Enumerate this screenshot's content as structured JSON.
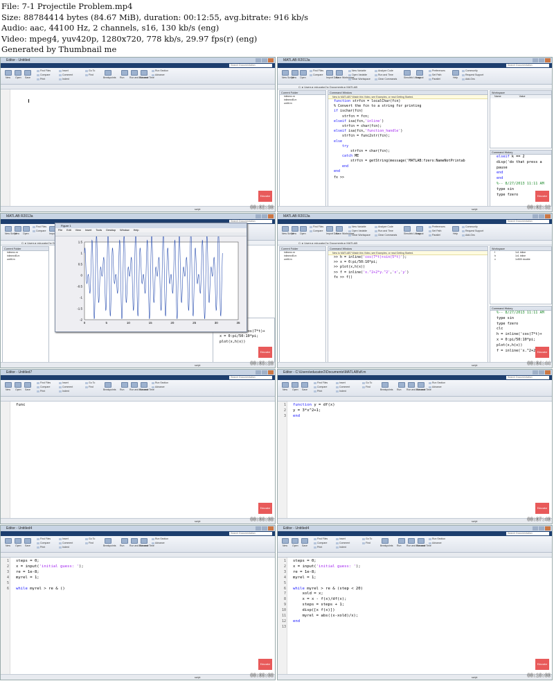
{
  "header": {
    "file": "File: 7-1 Projectile Problem.mp4",
    "size": "Size: 88784414 bytes (84.67 MiB), duration: 00:12:55, avg.bitrate: 916 kb/s",
    "audio": "Audio: aac, 44100 Hz, 2 channels, s16, 130 kb/s (eng)",
    "video": "Video: mpeg4, yuv420p, 1280x720, 778 kb/s, 29.97 fps(r) (eng)",
    "generated": "Generated by Thumbnail me"
  },
  "common": {
    "brand": "Educator",
    "search_placeholder": "Search Documentation",
    "tabs_editor": [
      "HOME",
      "PUBLISH",
      "VIEW"
    ],
    "tabs_desktop": [
      "HOME",
      "PLOTS",
      "APPS"
    ],
    "editor_buttons": [
      "New",
      "Open",
      "Save",
      "Find Files",
      "Compare",
      "Print",
      "Insert",
      "Comment",
      "Indent",
      "Go To",
      "Find",
      "Breakpoints",
      "Run",
      "Run and Advance",
      "Run and Time",
      "Run Section",
      "Advance"
    ],
    "desktop_buttons": [
      "New Script",
      "New",
      "Open",
      "Find Files",
      "Compare",
      "Import Data",
      "Save Workspace",
      "New Variable",
      "Open Variable",
      "Clear Workspace",
      "Analyze Code",
      "Run and Time",
      "Clear Commands",
      "Simulink Library",
      "Layout",
      "Preferences",
      "Set Path",
      "Parallel",
      "Help",
      "Community",
      "Request Support",
      "Add-Ons"
    ],
    "path": "C: ▸ Users ▸ educator2 ▸ Documents ▸ MATLAB",
    "status": "script",
    "ws_head": [
      "Name",
      "Value"
    ]
  },
  "frames": [
    {
      "timestamp": "00:02:36",
      "title": "Editor - Untitled",
      "doc_tabs": [
        "Untitled"
      ],
      "code": []
    },
    {
      "timestamp": "00:02:32",
      "title": "MATLAB R2013a",
      "files": [
        "Current Folder",
        "inlinexx.m",
        "inlinexxB.m",
        "untitl.m"
      ],
      "banner": "New to MATLAB? Watch this Video, see Examples, or read Getting Started.",
      "panel_title": "Command Window",
      "cmd": [
        "function strfcn = localChar(fcn)",
        "% Convert the fcn to a string for printing",
        "",
        "if ischar(fcn)",
        "    strfcn = fcn;",
        "elseif isa(fcn,'inline')",
        "    strfcn = char(fcn);",
        "elseif isa(fcn,'function_handle')",
        "    strfcn = func2str(fcn);",
        "else",
        "    try",
        "        strfcn = char(fcn);",
        "    catch ME",
        "        strfcn = getString(message('MATLAB:fzero:NameNotPrintab",
        "    end",
        "end"
      ],
      "prompt": "fx >>",
      "workspace": "Workspace",
      "history_title": "Command History",
      "history": [
        "elseif k == 2",
        "disp('do that press a",
        "pause",
        "end",
        "end",
        "%-- 8/27/2013 11:11 AM",
        "type sin",
        "type fzero"
      ]
    },
    {
      "timestamp": "00:03:28",
      "title": "MATLAB R2013a",
      "figure_title": "Figure 1",
      "figure_menu": [
        "File",
        "Edit",
        "View",
        "Insert",
        "Tools",
        "Desktop",
        "Window",
        "Help"
      ],
      "history": [
        "type fzero",
        "clc",
        "h = inline('cos(7*t)+",
        "x = 0:pi/50:10*pi;",
        "plot(x,h(x))"
      ],
      "y_ticks": [
        "1.5",
        "1",
        "0.5",
        "0",
        "-0.5",
        "-1",
        "-1.5",
        "-2"
      ],
      "x_ticks": [
        "0",
        "5",
        "10",
        "15",
        "20",
        "25",
        "30",
        "35"
      ]
    },
    {
      "timestamp": "00:04:44",
      "title": "MATLAB R2013a",
      "cmd": [
        ">> h = inline('cos(7*t)+sin(5*t)');",
        ">> x = 0:pi/50:10*pi;",
        ">> plot(x,h(x))",
        ">> f = inline('x.^2+2*y.^2','x','y')",
        "fx >> f()"
      ],
      "workspace_rows": [
        [
          "f",
          "1x1 inline"
        ],
        [
          "h",
          "1x1 inline"
        ],
        [
          "x",
          "1x500 double"
        ]
      ],
      "history": [
        "%-- 8/27/2013 11:11 AM",
        "type sin",
        "type fzero",
        "clc",
        "h = inline('cos(7*t)+",
        "x = 0:pi/50:10*pi;",
        "plot(x,h(x))",
        "f = inline('x.^2+2*y"
      ]
    },
    {
      "timestamp": "00:06:08",
      "title": "Editor - Untitled7",
      "doc_tabs": [
        "Untitled",
        "Untitled7"
      ],
      "code": [
        "func"
      ]
    },
    {
      "timestamp": "00:07:40",
      "title": "Editor - C:\\Users\\educator2\\Documents\\MATLAB\\df.m",
      "doc_tabs": [
        "Untitled",
        "f.m",
        "df.m"
      ],
      "code": [
        "function y = df(x)",
        "y = 3*x^2+1;",
        "end"
      ]
    },
    {
      "timestamp": "00:09:08",
      "title": "Editor - Untitled4",
      "doc_tabs": [
        "Untitled",
        "f.m",
        "df.m",
        "Untitled4"
      ],
      "code": [
        "steps = 0;",
        "x = input('initial guess: ');",
        "re = 1e-8;",
        "myrel = 1;",
        "",
        "while myrel > re & ()"
      ]
    },
    {
      "timestamp": "00:10:00",
      "title": "Editor - Untitled4",
      "doc_tabs": [
        "Untitled",
        "f.m",
        "df.m",
        "Untitled4"
      ],
      "code": [
        "steps = 0;",
        "x = input('initial guess: ');",
        "re = 1e-8;",
        "myrel = 1;",
        "",
        "while myrel > re & (step < 20)",
        "    xold = x;",
        "    x = x - f(x)/df(x);",
        "    steps = steps + 1;",
        "    disp([x f(x)])",
        "    myrel = abs((x-xold)/x);",
        "end",
        ""
      ]
    }
  ]
}
